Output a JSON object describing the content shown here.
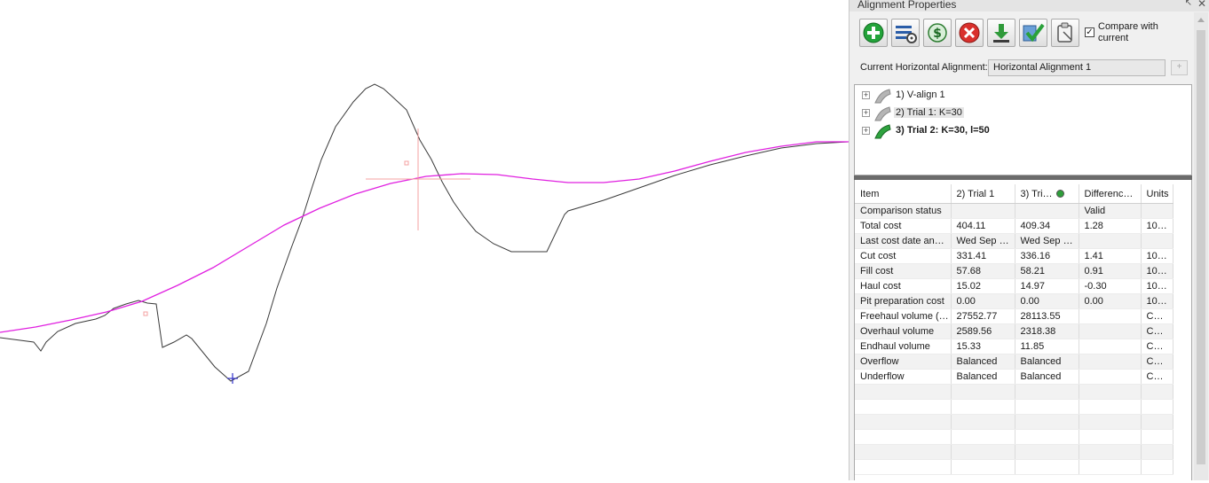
{
  "panel": {
    "title": "Alignment Properties",
    "pin_glyph": "↖",
    "close_glyph": "✕",
    "toolbar": [
      {
        "name": "add-alignment-button",
        "icon": "plus-circle-icon"
      },
      {
        "name": "alignment-settings-button",
        "icon": "list-gear-icon"
      },
      {
        "name": "cost-button",
        "icon": "dollar-icon"
      },
      {
        "name": "delete-alignment-button",
        "icon": "red-x-icon"
      },
      {
        "name": "download-button",
        "icon": "download-arrow-icon"
      },
      {
        "name": "accept-alignment-button",
        "icon": "check-icon"
      },
      {
        "name": "copy-report-button",
        "icon": "clipboard-icon"
      }
    ],
    "compare": {
      "checked": "✓",
      "label": "Compare with current"
    },
    "current_alignment": {
      "label": "Current Horizontal Alignment:",
      "value": "Horizontal Alignment 1",
      "button": "+"
    },
    "tree": {
      "expander": "+",
      "items": [
        {
          "label": "1) V-align 1",
          "active": false
        },
        {
          "label": "2) Trial 1: K=30",
          "active": false
        },
        {
          "label": "3) Trial 2: K=30, l=50",
          "active": true
        }
      ]
    },
    "grid": {
      "headers": [
        "Item",
        "2) Trial 1",
        "3) Tri…",
        "Differenc…",
        "Units"
      ],
      "rows": [
        [
          "Comparison status",
          "",
          "",
          "Valid",
          ""
        ],
        [
          "Total cost",
          "404.11",
          "409.34",
          "1.28",
          "10…"
        ],
        [
          "Last cost date an…",
          "Wed Sep …",
          "Wed Sep …",
          "",
          ""
        ],
        [
          "Cut cost",
          "331.41",
          "336.16",
          "1.41",
          "10…"
        ],
        [
          "Fill cost",
          "57.68",
          "58.21",
          "0.91",
          "10…"
        ],
        [
          "Haul cost",
          "15.02",
          "14.97",
          "-0.30",
          "10…"
        ],
        [
          "Pit preparation cost",
          "0.00",
          "0.00",
          "0.00",
          "10…"
        ],
        [
          "Freehaul volume (…",
          "27552.77",
          "28113.55",
          "",
          "C…"
        ],
        [
          "Overhaul volume",
          "2589.56",
          "2318.38",
          "",
          "C…"
        ],
        [
          "Endhaul volume",
          "15.33",
          "11.85",
          "",
          "C…"
        ],
        [
          "Overflow",
          "Balanced",
          "Balanced",
          "",
          "C…"
        ],
        [
          "Underflow",
          "Balanced",
          "Balanced",
          "",
          "C…"
        ],
        [
          "",
          "",
          "",
          "",
          ""
        ],
        [
          "",
          "",
          "",
          "",
          ""
        ],
        [
          "",
          "",
          "",
          "",
          ""
        ],
        [
          "",
          "",
          "",
          "",
          ""
        ],
        [
          "",
          "",
          "",
          "",
          ""
        ],
        [
          "",
          "",
          "",
          "",
          ""
        ]
      ]
    }
  },
  "colors": {
    "ground_line": "#3a3a3a",
    "design_line": "#e020e0",
    "crosshair": "#f4a0a0",
    "marker": "#3333cc"
  }
}
